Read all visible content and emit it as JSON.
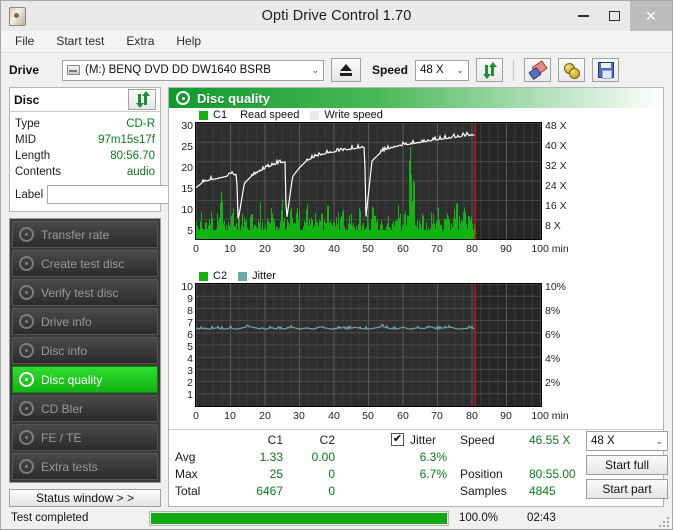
{
  "window": {
    "title": "Opti Drive Control 1.70",
    "app_icon": "disc-icon",
    "minimize": "–",
    "maximize": "□",
    "close": "✕"
  },
  "menu": {
    "items": [
      "File",
      "Start test",
      "Extra",
      "Help"
    ]
  },
  "toolbar": {
    "drive_label": "Drive",
    "drive_value": "(M:)   BENQ DVD DD DW1640 BSRB",
    "drive_icon": "drive-icon",
    "eject_icon": "eject-icon",
    "speed_label": "Speed",
    "speed_value": "48 X",
    "refresh_icon": "refresh-icon",
    "erase_icon": "erase-disc-icon",
    "bitsetting_icon": "gold-coins-icon",
    "save_icon": "save-icon"
  },
  "disc_panel": {
    "title": "Disc",
    "refresh_icon": "refresh-icon",
    "rows": [
      {
        "key": "Type",
        "value": "CD-R"
      },
      {
        "key": "MID",
        "value": "97m15s17f"
      },
      {
        "key": "Length",
        "value": "80:56.70"
      },
      {
        "key": "Contents",
        "value": "audio"
      }
    ],
    "label_key": "Label",
    "label_value": "",
    "label_placeholder": "",
    "cd_button_icon": "cd-disc-icon"
  },
  "sidebar": {
    "items": [
      {
        "label": "Transfer rate",
        "icon": "disc-icon",
        "active": false
      },
      {
        "label": "Create test disc",
        "icon": "disc-write-icon",
        "active": false
      },
      {
        "label": "Verify test disc",
        "icon": "disc-check-icon",
        "active": false
      },
      {
        "label": "Drive info",
        "icon": "drive-info-icon",
        "active": false
      },
      {
        "label": "Disc info",
        "icon": "disc-info-icon",
        "active": false
      },
      {
        "label": "Disc quality",
        "icon": "disc-quality-icon",
        "active": true
      },
      {
        "label": "CD Bler",
        "icon": "disc-bler-icon",
        "active": false
      },
      {
        "label": "FE / TE",
        "icon": "disc-fete-icon",
        "active": false
      },
      {
        "label": "Extra tests",
        "icon": "disc-extra-icon",
        "active": false
      }
    ],
    "status_button": "Status window > >"
  },
  "panel": {
    "header_title": "Disc quality",
    "header_icon": "disc-quality-icon"
  },
  "chart_data": [
    {
      "id": "c1-chart",
      "type": "area",
      "title": "",
      "legend": [
        {
          "label": "C1",
          "color": "#11b511",
          "swatch": true
        },
        {
          "label": "Read speed",
          "color": "#ffffff",
          "swatch": false
        },
        {
          "label": "Write speed",
          "color": "#e8e8e8",
          "swatch": true
        }
      ],
      "legend_position": "top-left",
      "xlabel": "min",
      "xlim": [
        0,
        100
      ],
      "xticks": [
        0,
        10,
        20,
        30,
        40,
        50,
        60,
        70,
        80,
        90,
        100
      ],
      "xticklabels": [
        "0",
        "10",
        "20",
        "30",
        "40",
        "50",
        "60",
        "70",
        "80",
        "90",
        "100 min"
      ],
      "ylabel": "",
      "ylim": [
        0,
        30
      ],
      "yticks": [
        5,
        10,
        15,
        20,
        25,
        30
      ],
      "yticklabels": [
        "5",
        "10",
        "15",
        "20",
        "25",
        "30"
      ],
      "y2lim": [
        0,
        52
      ],
      "y2ticks": [
        8,
        16,
        24,
        32,
        40,
        48
      ],
      "y2ticklabels": [
        "8 X",
        "16 X",
        "24 X",
        "32 X",
        "40 X",
        "48 X"
      ],
      "grid": true,
      "data_end_x": 80.92,
      "cursor_x": 80.92,
      "cursor_color": "#e01010",
      "series": [
        {
          "name": "C1",
          "color": "#11b511",
          "axis": "left",
          "type": "bar",
          "description": "dense green error spikes, baseline approx 2-4, frequent spikes 6-12, large spike ~25 near 63 min",
          "x": [
            0,
            0.8,
            1.6,
            2.4,
            3.2,
            4,
            4.8,
            5.6,
            6.4,
            7.2,
            8,
            8.8,
            9.6,
            10.4,
            11.2,
            12,
            12.8,
            13.6,
            14.4,
            15.2,
            16,
            16.8,
            17.6,
            18.4,
            19.2,
            20,
            20.8,
            21.6,
            22.4,
            23.2,
            24,
            24.8,
            25.6,
            26.4,
            27.2,
            28,
            28.8,
            29.6,
            30.4,
            31.2,
            32,
            32.8,
            33.6,
            34.4,
            35.2,
            36,
            36.8,
            37.6,
            38.4,
            39.2,
            40,
            40.8,
            41.6,
            42.4,
            43.2,
            44,
            44.8,
            45.6,
            46.4,
            47.2,
            48,
            48.8,
            49.6,
            50.4,
            51.2,
            52,
            52.8,
            53.6,
            54.4,
            55.2,
            56,
            56.8,
            57.6,
            58.4,
            59.2,
            60,
            60.8,
            61.6,
            62.4,
            63.2,
            64,
            64.8,
            65.6,
            66.4,
            67.2,
            68,
            68.8,
            69.6,
            70.4,
            71.2,
            72,
            72.8,
            73.6,
            74.4,
            75.2,
            76,
            76.8,
            77.6,
            78.4,
            79.2,
            80,
            80.9
          ],
          "values": [
            5,
            4,
            6,
            3,
            5,
            9,
            4,
            3,
            7,
            12,
            4,
            5,
            3,
            11,
            4,
            6,
            3,
            9,
            5,
            4,
            7,
            3,
            5,
            10,
            4,
            3,
            6,
            8,
            4,
            5,
            3,
            9,
            5,
            4,
            11,
            3,
            5,
            7,
            4,
            3,
            9,
            5,
            4,
            6,
            3,
            8,
            5,
            4,
            10,
            3,
            5,
            7,
            4,
            9,
            3,
            5,
            6,
            4,
            3,
            8,
            5,
            4,
            7,
            3,
            9,
            5,
            4,
            6,
            3,
            5,
            8,
            4,
            3,
            10,
            5,
            4,
            7,
            14,
            25,
            12,
            6,
            5,
            9,
            4,
            3,
            6,
            5,
            4,
            8,
            3,
            5,
            7,
            4,
            3,
            13,
            5,
            4,
            9,
            3,
            6,
            4,
            3
          ]
        },
        {
          "name": "Read speed",
          "color": "#ffffff",
          "axis": "right",
          "type": "line",
          "description": "CAV stepped read speed with 3 drops (resets) at ~12, ~26, ~49 min",
          "x": [
            0,
            2,
            4,
            6,
            8,
            10,
            11.8,
            12.2,
            14,
            16,
            18,
            20,
            22,
            24,
            25.8,
            26.2,
            28,
            30,
            32,
            34,
            36,
            38,
            40,
            42,
            44,
            46,
            48,
            48.9,
            49.2,
            51,
            53,
            55,
            58,
            62,
            66,
            70,
            75,
            80,
            80.9
          ],
          "values": [
            23,
            25.5,
            26.5,
            27,
            27.8,
            28.5,
            29,
            8,
            25,
            28,
            30,
            31.5,
            33,
            34,
            34.5,
            8,
            28,
            32,
            35,
            36.5,
            37.5,
            38.5,
            39,
            39.5,
            40,
            40.5,
            41,
            41.2,
            9,
            35,
            38,
            40,
            41.5,
            42.5,
            43.5,
            44.5,
            45.5,
            46.5,
            46.55
          ]
        }
      ]
    },
    {
      "id": "c2-jitter-chart",
      "type": "line",
      "title": "",
      "legend": [
        {
          "label": "C2",
          "color": "#11b511",
          "swatch": true
        },
        {
          "label": "Jitter",
          "color": "#6ba8ad",
          "swatch": true
        }
      ],
      "legend_position": "top-left",
      "xlabel": "min",
      "xlim": [
        0,
        100
      ],
      "xticks": [
        0,
        10,
        20,
        30,
        40,
        50,
        60,
        70,
        80,
        90,
        100
      ],
      "xticklabels": [
        "0",
        "10",
        "20",
        "30",
        "40",
        "50",
        "60",
        "70",
        "80",
        "90",
        "100 min"
      ],
      "ylim": [
        0,
        10
      ],
      "yticks": [
        1,
        2,
        3,
        4,
        5,
        6,
        7,
        8,
        9,
        10
      ],
      "yticklabels": [
        "1",
        "2",
        "3",
        "4",
        "5",
        "6",
        "7",
        "8",
        "9",
        "10"
      ],
      "y2lim": [
        0,
        10
      ],
      "y2ticks": [
        2,
        4,
        6,
        8,
        10
      ],
      "y2ticklabels": [
        "2%",
        "4%",
        "6%",
        "8%",
        "10%"
      ],
      "grid": true,
      "data_end_x": 80.92,
      "cursor_x": 80.92,
      "cursor_color": "#e01010",
      "series": [
        {
          "name": "C2",
          "color": "#11b511",
          "axis": "left",
          "type": "bar",
          "description": "no C2 errors, flat at zero",
          "x": [
            0,
            80.9
          ],
          "values": [
            0,
            0
          ]
        },
        {
          "name": "Jitter",
          "color": "#6ba8ad",
          "axis": "right",
          "type": "line",
          "description": "flat near 6.3% with small ripples up to 6.7%",
          "x": [
            0,
            2,
            4,
            6,
            8,
            10,
            12,
            14,
            16,
            18,
            20,
            22,
            24,
            26,
            28,
            30,
            32,
            34,
            36,
            38,
            40,
            42,
            44,
            46,
            48,
            50,
            52,
            54,
            56,
            58,
            60,
            62,
            64,
            66,
            68,
            70,
            72,
            74,
            76,
            78,
            80,
            80.9
          ],
          "values": [
            6.3,
            6.35,
            6.3,
            6.4,
            6.3,
            6.35,
            6.3,
            6.45,
            6.5,
            6.35,
            6.3,
            6.4,
            6.3,
            6.35,
            6.45,
            6.3,
            6.4,
            6.3,
            6.5,
            6.35,
            6.3,
            6.4,
            6.3,
            6.45,
            6.35,
            6.3,
            6.4,
            6.5,
            6.35,
            6.3,
            6.45,
            6.3,
            6.4,
            6.35,
            6.5,
            6.3,
            6.4,
            6.45,
            6.3,
            6.35,
            6.4,
            6.3
          ]
        }
      ]
    }
  ],
  "stats": {
    "col_headers": [
      "C1",
      "C2"
    ],
    "rows": [
      {
        "label": "Avg",
        "c1": "1.33",
        "c2": "0.00",
        "jitter": "6.3%"
      },
      {
        "label": "Max",
        "c1": "25",
        "c2": "0",
        "jitter": "6.7%"
      },
      {
        "label": "Total",
        "c1": "6467",
        "c2": "0",
        "jitter": ""
      }
    ],
    "jitter_checkbox_label": "Jitter",
    "jitter_checked": true,
    "check_glyph": "✔",
    "info": [
      {
        "key": "Speed",
        "value": "46.55 X"
      },
      {
        "key": "Position",
        "value": "80:55.00"
      },
      {
        "key": "Samples",
        "value": "4845"
      }
    ],
    "speed_select": "48 X",
    "start_full": "Start full",
    "start_part": "Start part"
  },
  "statusbar": {
    "message": "Test completed",
    "progress_percent": "100.0%",
    "progress_value": 100,
    "elapsed": "02:43"
  },
  "colors": {
    "accent_green": "#11b511",
    "value_green": "#0d7a1e",
    "cursor_red": "#e01010",
    "jitter_teal": "#6ba8ad",
    "plot_bg": "#2a2a2a"
  }
}
